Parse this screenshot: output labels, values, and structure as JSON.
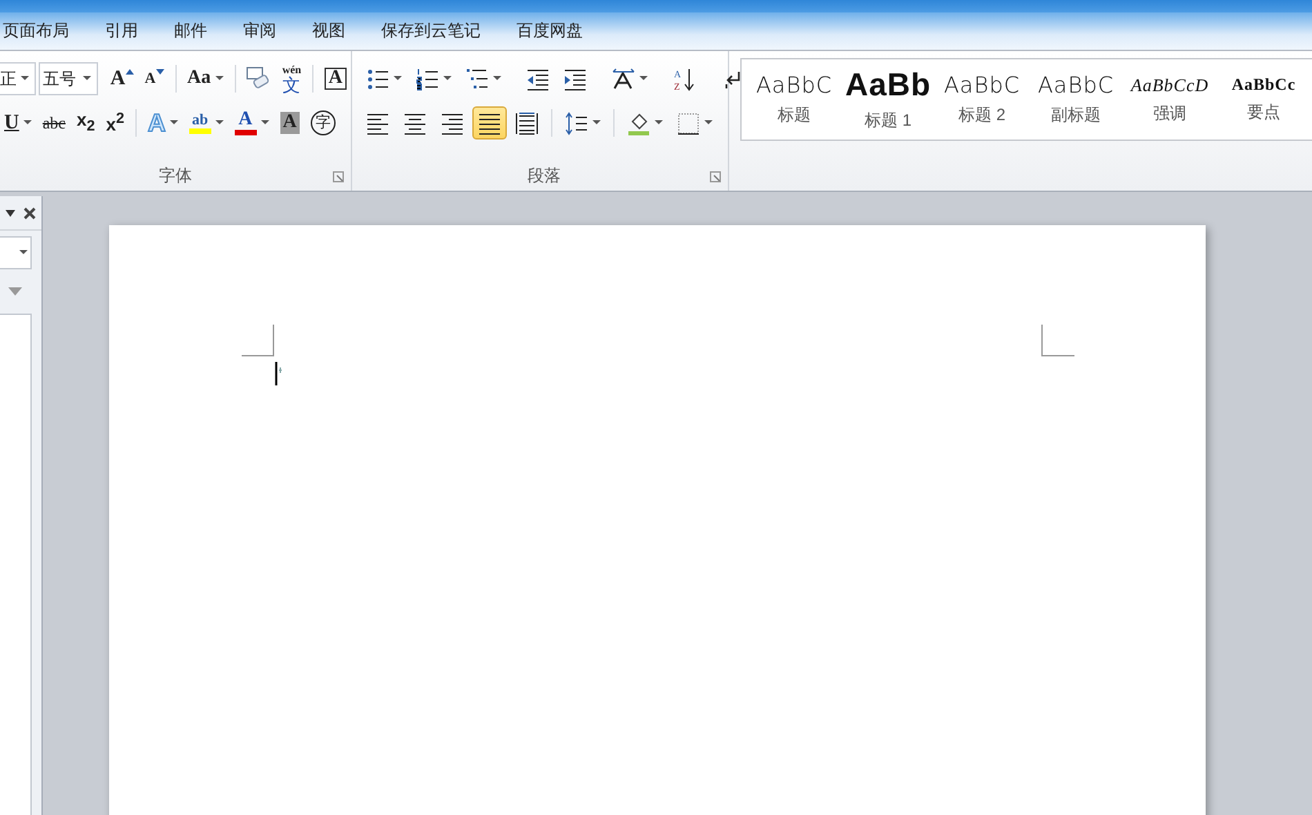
{
  "tabs": [
    {
      "label": "页面布局",
      "selected": false
    },
    {
      "label": "引用",
      "selected": false
    },
    {
      "label": "邮件",
      "selected": false
    },
    {
      "label": "审阅",
      "selected": false
    },
    {
      "label": "视图",
      "selected": false
    },
    {
      "label": "保存到云笔记",
      "selected": false
    },
    {
      "label": "百度网盘",
      "selected": false
    }
  ],
  "font_group": {
    "label": "字体",
    "font_name": "正",
    "font_size": "五号",
    "row1": [
      {
        "kind": "grow",
        "glyph": "A",
        "dropdown": false
      },
      {
        "kind": "shrink",
        "glyph": "A",
        "dropdown": false
      },
      {
        "kind": "case",
        "glyph": "Aa",
        "dropdown": true
      },
      {
        "kind": "clear",
        "dropdown": false
      },
      {
        "kind": "phonetic",
        "glyph": "文",
        "top": "wén",
        "dropdown": false
      },
      {
        "kind": "border",
        "glyph": "A",
        "dropdown": false
      }
    ],
    "row2": [
      {
        "kind": "underline",
        "glyph": "U",
        "dropdown": true
      },
      {
        "kind": "strike",
        "glyph": "abc",
        "dropdown": false
      },
      {
        "kind": "script",
        "glyph": "x$_{2}$",
        "dropdown": false
      },
      {
        "kind": "script",
        "glyph": "x$^{2}$",
        "dropdown": false
      },
      {
        "kind": "effects",
        "glyph": "A",
        "dropdown": true
      },
      {
        "kind": "highlight",
        "glyph": "ab",
        "dropdown": true
      },
      {
        "kind": "color",
        "glyph": "A",
        "dropdown": true
      },
      {
        "kind": "shade",
        "glyph": "A",
        "dropdown": false
      },
      {
        "kind": "enclose",
        "glyph": "字",
        "dropdown": false
      }
    ]
  },
  "paragraph_group": {
    "label": "段落",
    "row1": [
      {
        "kind": "bullets",
        "dropdown": true
      },
      {
        "kind": "numbering",
        "dropdown": true
      },
      {
        "kind": "multilevel",
        "dropdown": true
      },
      {
        "kind": "outdent",
        "dropdown": false
      },
      {
        "kind": "indent",
        "dropdown": false
      },
      {
        "kind": "asian",
        "dropdown": true
      },
      {
        "kind": "sort",
        "dropdown": false,
        "glyph": "A",
        "glyph2": "Z"
      },
      {
        "kind": "marks",
        "dropdown": false
      }
    ],
    "row2": [
      {
        "kind": "left",
        "dropdown": false,
        "selected": false
      },
      {
        "kind": "center",
        "dropdown": false,
        "selected": false
      },
      {
        "kind": "right",
        "dropdown": false,
        "selected": false
      },
      {
        "kind": "justify",
        "dropdown": false,
        "selected": true
      },
      {
        "kind": "distributed",
        "dropdown": false,
        "selected": false
      },
      {
        "kind": "spacing",
        "dropdown": true,
        "selected": false
      },
      {
        "kind": "shading",
        "dropdown": true,
        "selected": false
      },
      {
        "kind": "borders",
        "dropdown": true,
        "selected": false
      }
    ]
  },
  "styles": [
    {
      "preview": "AaBbC",
      "label": "标题",
      "kind": "light"
    },
    {
      "preview": "AaBb",
      "label": "标题 1",
      "kind": "heavy"
    },
    {
      "preview": "AaBbC",
      "label": "标题 2",
      "kind": "light"
    },
    {
      "preview": "AaBbC",
      "label": "副标题",
      "kind": "light"
    },
    {
      "preview": "AaBbCcD",
      "label": "强调",
      "kind": "italic"
    },
    {
      "preview": "AaBbCc",
      "label": "要点",
      "kind": "serifbold"
    }
  ]
}
